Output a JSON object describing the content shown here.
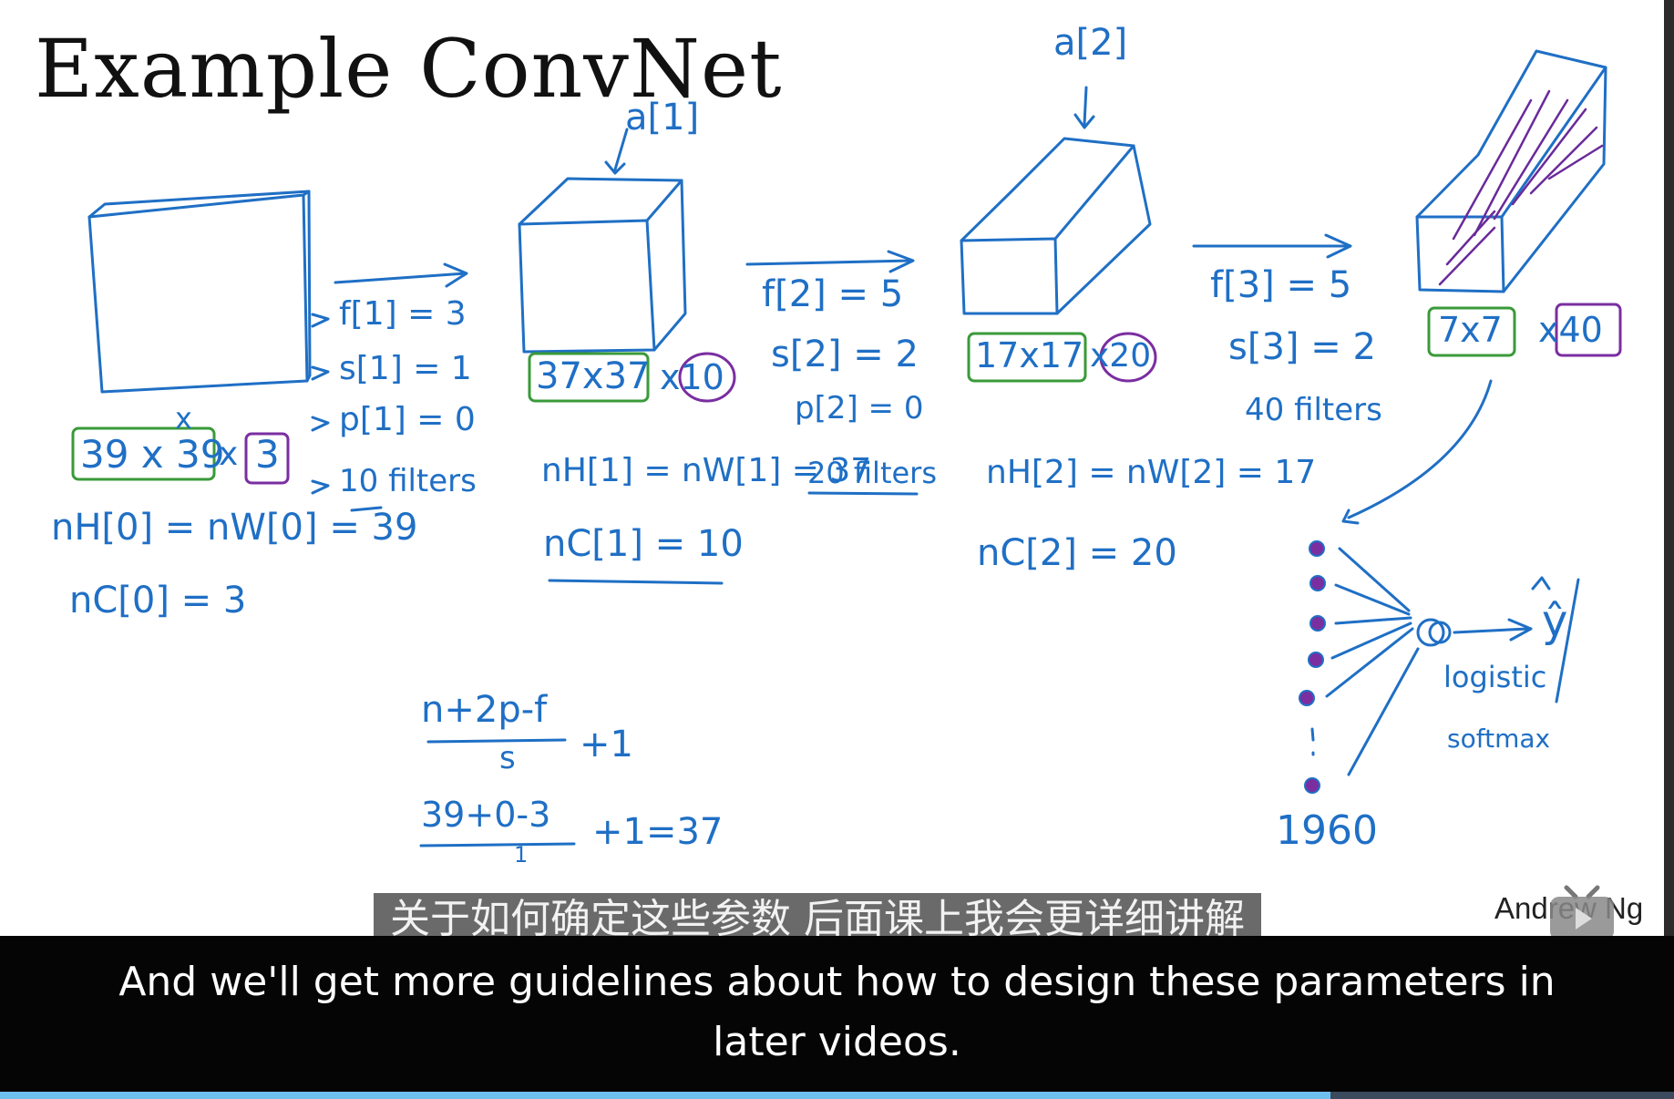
{
  "slide": {
    "title": "Example ConvNet",
    "author": "Andrew Ng"
  },
  "layer0": {
    "dims": "39 x 39",
    "channels_mult": "x",
    "channels": "3",
    "x_label": "x",
    "nH_eq": "nH[0] = nW[0] = 39",
    "nC_eq": "nC[0] = 3"
  },
  "hyper1": {
    "f": "f[1] = 3",
    "s": "s[1] = 1",
    "p": "p[1] = 0",
    "filters": "10 filters"
  },
  "layer1": {
    "activation": "a[1]",
    "dims": "37x37",
    "channels": "x10",
    "nH_eq": "nH[1] = nW[1] = 37",
    "nC_eq": "nC[1] = 10"
  },
  "hyper2": {
    "f": "f[2] = 5",
    "s": "s[2] = 2",
    "p": "p[2] = 0",
    "filters": "20 filters"
  },
  "layer2": {
    "activation": "a[2]",
    "dims": "17x17",
    "channels": "x20",
    "nH_eq": "nH[2] = nW[2] = 17",
    "nC_eq": "nC[2] = 20"
  },
  "hyper3": {
    "f": "f[3] = 5",
    "s": "s[3] = 2",
    "filters": "40 filters"
  },
  "layer3": {
    "dims": "7x7",
    "channels": "x40"
  },
  "output": {
    "count": "1960",
    "yhat": "ŷ",
    "logistic": "logistic",
    "softmax": "softmax"
  },
  "formula": {
    "num": "n+2p-f",
    "den": "s",
    "plus": "+1",
    "ex_num": "39+0-3",
    "ex_den": "1",
    "ex_res": "+1=37"
  },
  "subtitles": {
    "zh": "关于如何确定这些参数 后面课上我会更详细讲解",
    "en_line1": "And we'll get more guidelines about how to design these parameters in",
    "en_line2": "later videos."
  },
  "player": {
    "progress": 0.795,
    "progress_color": "#6ec0ee",
    "watermark_icon": "tv-icon"
  },
  "colors": {
    "ink_blue": "#1f6fc5",
    "box_green": "#3a9a3a",
    "box_purple": "#7a2ea0",
    "hatch_purple": "#6a2a9a"
  }
}
